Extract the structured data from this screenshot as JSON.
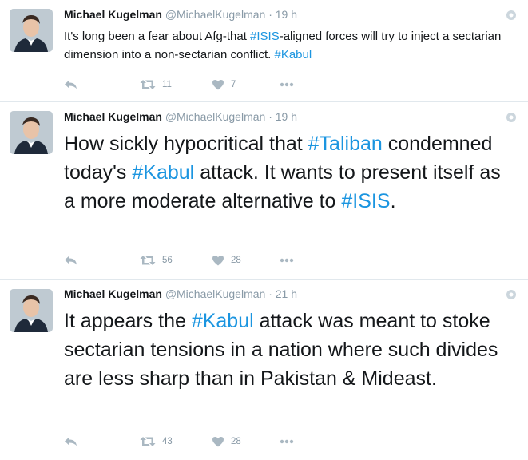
{
  "tweets": [
    {
      "author_name": "Michael Kugelman",
      "handle": "@MichaelKugelman",
      "separator": "·",
      "time": "19 h",
      "text_segments": [
        {
          "text": "It's long been a fear about Afg-that ",
          "hashtag": false
        },
        {
          "text": "#ISIS",
          "hashtag": true
        },
        {
          "text": "-aligned forces will try to inject a sectarian dimension into a non-sectarian conflict. ",
          "hashtag": false
        },
        {
          "text": "#Kabul",
          "hashtag": true
        }
      ],
      "retweets": "11",
      "likes": "7"
    },
    {
      "author_name": "Michael Kugelman",
      "handle": "@MichaelKugelman",
      "separator": "·",
      "time": "19 h",
      "text_segments": [
        {
          "text": "How sickly hypocritical that ",
          "hashtag": false
        },
        {
          "text": "#Taliban",
          "hashtag": true
        },
        {
          "text": " condemned today's ",
          "hashtag": false
        },
        {
          "text": "#Kabul",
          "hashtag": true
        },
        {
          "text": " attack. It wants to present itself as a more moderate alternative to ",
          "hashtag": false
        },
        {
          "text": "#ISIS",
          "hashtag": true
        },
        {
          "text": ".",
          "hashtag": false
        }
      ],
      "retweets": "56",
      "likes": "28"
    },
    {
      "author_name": "Michael Kugelman",
      "handle": "@MichaelKugelman",
      "separator": "·",
      "time": "21 h",
      "text_segments": [
        {
          "text": "It appears the ",
          "hashtag": false
        },
        {
          "text": "#Kabul",
          "hashtag": true
        },
        {
          "text": " attack was meant to stoke sectarian tensions in a nation where such divides are less sharp than in Pakistan & Mideast.",
          "hashtag": false
        }
      ],
      "retweets": "43",
      "likes": "28"
    }
  ],
  "icons": {
    "reply": "reply-icon",
    "retweet": "retweet-icon",
    "like": "heart-icon",
    "more": "more-dots-icon",
    "settings": "gear-icon"
  },
  "colors": {
    "hashtag": "#1b95e0",
    "meta": "#8899a6",
    "divider": "#e1e8ed",
    "text": "#14171a"
  }
}
